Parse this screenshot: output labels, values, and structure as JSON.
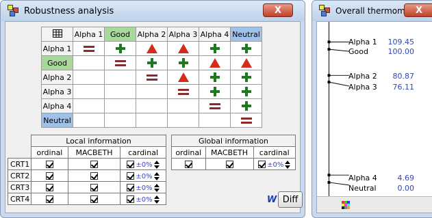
{
  "robust": {
    "title": "Robustness analysis",
    "close": "X",
    "corner_icon": "table-icon",
    "col_headers": [
      "Alpha 1",
      "Good",
      "Alpha 2",
      "Alpha 3",
      "Alpha 4",
      "Neutral"
    ],
    "rows": [
      {
        "label": "Alpha 1",
        "cells": [
          "eq",
          "plus",
          "tri",
          "tri",
          "plus",
          "plus"
        ]
      },
      {
        "label": "Good",
        "cells": [
          "",
          "eq",
          "plus",
          "plus",
          "tri",
          "tri"
        ]
      },
      {
        "label": "Alpha 2",
        "cells": [
          "",
          "",
          "eq",
          "tri",
          "plus",
          "plus"
        ]
      },
      {
        "label": "Alpha 3",
        "cells": [
          "",
          "",
          "",
          "eq",
          "plus",
          "plus"
        ]
      },
      {
        "label": "Alpha 4",
        "cells": [
          "",
          "",
          "",
          "",
          "eq",
          "plus"
        ]
      },
      {
        "label": "Neutral",
        "cells": [
          "",
          "",
          "",
          "",
          "",
          "eq"
        ]
      }
    ],
    "local_title": "Local information",
    "global_title": "Global information",
    "sub_headers": [
      "ordinal",
      "MACBETH",
      "cardinal"
    ],
    "criteria": [
      "CRT1",
      "CRT2",
      "CRT3",
      "CRT4"
    ],
    "pct": "±0%",
    "w_label": "W",
    "diff_label": "Diff"
  },
  "therm": {
    "title": "Overall thermometer",
    "close": "X",
    "items": [
      {
        "name": "Alpha 1",
        "value": "109.45"
      },
      {
        "name": "Good",
        "value": "100.00"
      },
      {
        "name": "Alpha 2",
        "value": "80.87"
      },
      {
        "name": "Alpha 3",
        "value": "76.11"
      },
      {
        "name": "Alpha 4",
        "value": "4.69"
      },
      {
        "name": "Neutral",
        "value": "0.00"
      }
    ]
  }
}
